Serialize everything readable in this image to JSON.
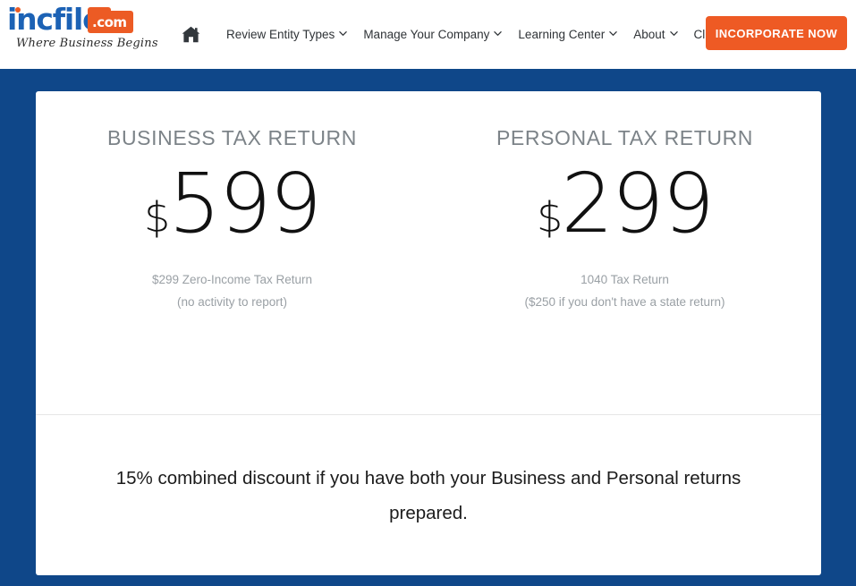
{
  "header": {
    "logo": {
      "wordmark": "incfile",
      "suffix": ".com",
      "tagline": "Where Business Begins",
      "brand_blue": "#1c62b5",
      "brand_orange": "#ec5b24"
    },
    "nav": {
      "home_icon": "home-icon",
      "items": [
        {
          "label": "Review Entity Types",
          "has_dropdown": true
        },
        {
          "label": "Manage Your Company",
          "has_dropdown": true
        },
        {
          "label": "Learning Center",
          "has_dropdown": true
        },
        {
          "label": "About",
          "has_dropdown": true
        },
        {
          "label": "Client Login",
          "has_dropdown": false
        }
      ]
    },
    "cta": {
      "label": "INCORPORATE NOW",
      "color": "#ee5a24"
    }
  },
  "stage": {
    "background_color": "#0f4789"
  },
  "card": {
    "plans": [
      {
        "title": "BUSINESS TAX RETURN",
        "currency": "$",
        "amount": "599",
        "note_line1": "$299 Zero-Income Tax Return",
        "note_line2": "(no activity to report)"
      },
      {
        "title": "PERSONAL TAX RETURN",
        "currency": "$",
        "amount": "299",
        "note_line1": "1040 Tax Return",
        "note_line2": "($250 if you don't have a state return)"
      }
    ],
    "footer_note": "15% combined discount if you have both your Business and Personal returns prepared."
  }
}
